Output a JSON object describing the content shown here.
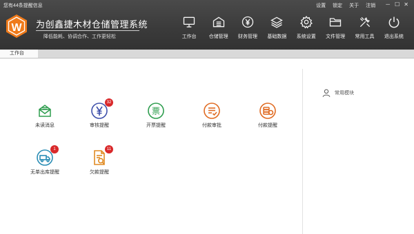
{
  "header": {
    "notice": "您有44条提醒信息",
    "links": [
      "设置",
      "锁定",
      "关于",
      "注销"
    ],
    "window_buttons": [
      "－",
      "☐",
      "✕"
    ],
    "logo_letter": "W",
    "title": "为创鑫捷木材仓储管理系统",
    "slogan": "降低能耗、协调合作、工作更轻松"
  },
  "nav": [
    {
      "label": "工作台",
      "icon": "monitor-icon"
    },
    {
      "label": "仓储管理",
      "icon": "warehouse-icon"
    },
    {
      "label": "财务管理",
      "icon": "yen-circle-icon"
    },
    {
      "label": "基础数据",
      "icon": "layers-icon"
    },
    {
      "label": "系统设置",
      "icon": "gear-icon"
    },
    {
      "label": "文件管理",
      "icon": "folder-icon"
    },
    {
      "label": "常用工具",
      "icon": "tools-icon"
    },
    {
      "label": "退出系统",
      "icon": "power-icon"
    }
  ],
  "tabs": {
    "active": "工作台"
  },
  "tiles": [
    {
      "label": "未读消息",
      "icon": "envelope-icon",
      "color": "#2e9d4e",
      "badge": null
    },
    {
      "label": "审核提醒",
      "icon": "yen-icon",
      "color": "#3d4faa",
      "badge": "32"
    },
    {
      "label": "开票提醒",
      "icon": "invoice-icon",
      "color": "#2e9d4e",
      "badge": null
    },
    {
      "label": "付款审批",
      "icon": "approval-icon",
      "color": "#e06b22",
      "badge": null
    },
    {
      "label": "付款提醒",
      "icon": "coins-icon",
      "color": "#e06b22",
      "badge": null
    },
    {
      "label": "无单出库提醒",
      "icon": "truck-icon",
      "color": "#2a8db5",
      "badge": "1"
    },
    {
      "label": "欠款提醒",
      "icon": "debt-icon",
      "color": "#e08a22",
      "badge": "11"
    }
  ],
  "right_panel": {
    "title": "常用模块",
    "icon": "user-icon"
  }
}
